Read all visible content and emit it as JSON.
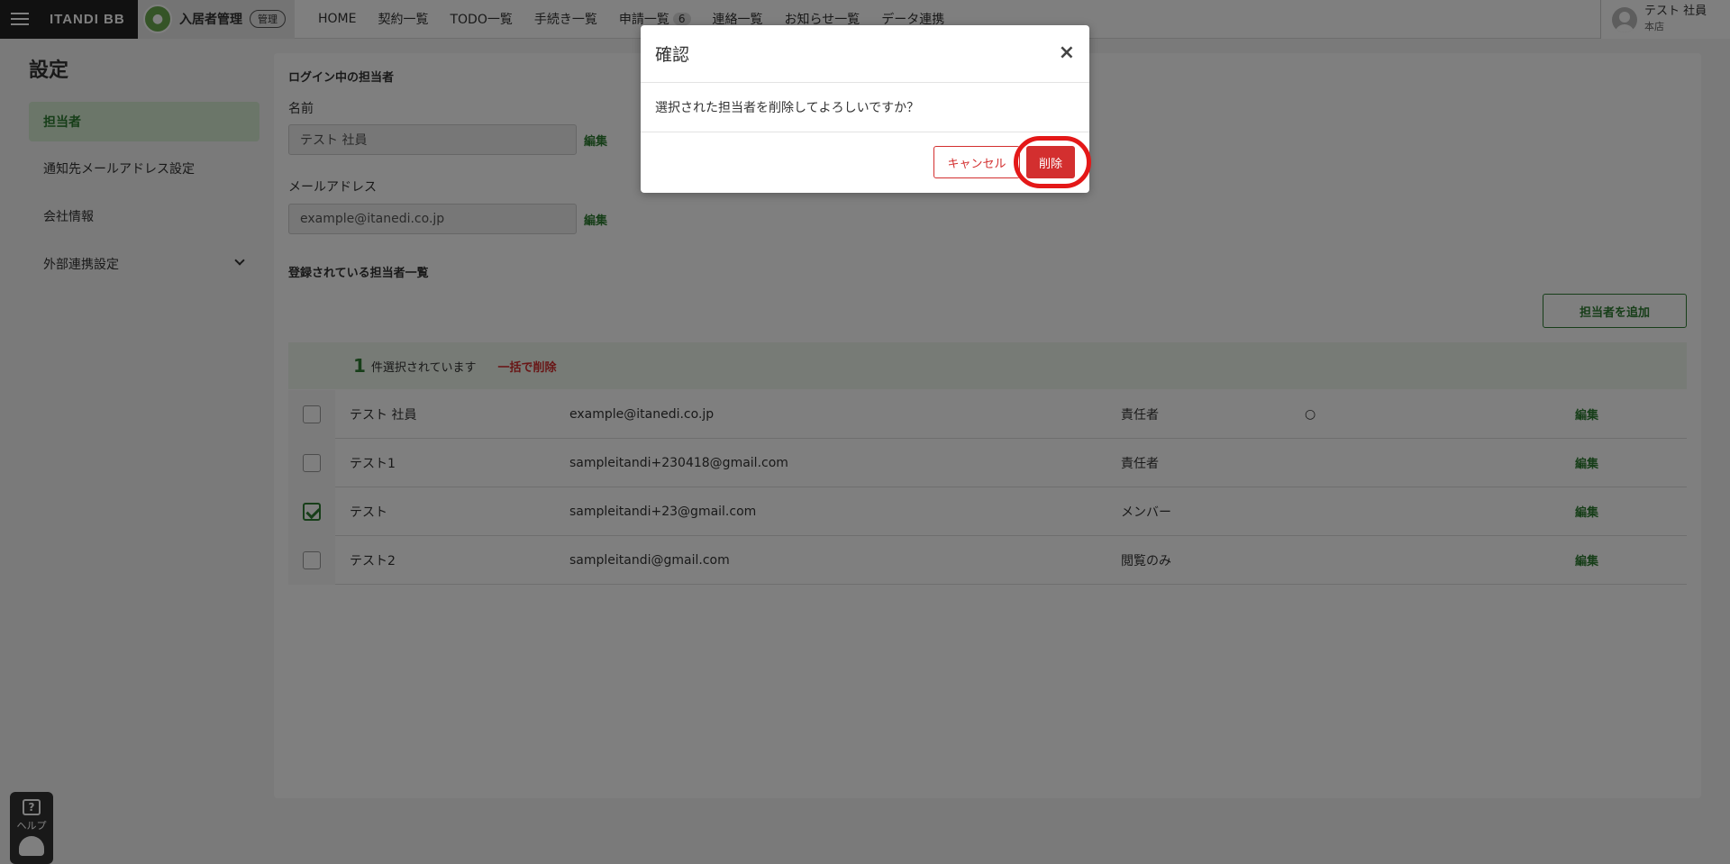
{
  "header": {
    "brand": "ITANDI BB",
    "app_name": "入居者管理",
    "app_badge": "管理",
    "nav": [
      {
        "label": "HOME"
      },
      {
        "label": "契約一覧"
      },
      {
        "label": "TODO一覧"
      },
      {
        "label": "手続き一覧"
      },
      {
        "label": "申請一覧",
        "count": "6"
      },
      {
        "label": "連絡一覧"
      },
      {
        "label": "お知らせ一覧"
      },
      {
        "label": "データ連携"
      }
    ],
    "user_name": "テスト 社員",
    "user_branch": "本店"
  },
  "sidebar": {
    "title": "設定",
    "items": [
      {
        "label": "担当者",
        "active": true
      },
      {
        "label": "通知先メールアドレス設定"
      },
      {
        "label": "会社情報"
      },
      {
        "label": "外部連携設定"
      }
    ]
  },
  "login_user": {
    "section_title": "ログイン中の担当者",
    "name_label": "名前",
    "name_value": "テスト 社員",
    "email_label": "メールアドレス",
    "email_value": "example@itanedi.co.jp",
    "edit_label": "編集"
  },
  "staff_list": {
    "section_title": "登録されている担当者一覧",
    "add_button": "担当者を追加",
    "selected_count": "1",
    "selected_text": "件選択されています",
    "bulk_delete": "一括で削除",
    "rows": [
      {
        "name": "テスト 社員",
        "email": "example@itanedi.co.jp",
        "role": "責任者",
        "mark": "○",
        "edit": "編集",
        "checked": false
      },
      {
        "name": "テスト1",
        "email": "sampleitandi+230418@gmail.com",
        "role": "責任者",
        "mark": "",
        "edit": "編集",
        "checked": false
      },
      {
        "name": "テスト",
        "email": "sampleitandi+23@gmail.com",
        "role": "メンバー",
        "mark": "",
        "edit": "編集",
        "checked": true
      },
      {
        "name": "テスト2",
        "email": "sampleitandi@gmail.com",
        "role": "閲覧のみ",
        "mark": "",
        "edit": "編集",
        "checked": false
      }
    ]
  },
  "help": {
    "label": "ヘルプ",
    "icon": "?"
  },
  "modal": {
    "title": "確認",
    "close": "×",
    "message": "選択された担当者を削除してよろしいですか？",
    "cancel_label": "キャンセル",
    "delete_label": "削除"
  },
  "colors": {
    "accent": "#2e7d32",
    "danger": "#d32f2f",
    "highlight": "#e41818"
  }
}
